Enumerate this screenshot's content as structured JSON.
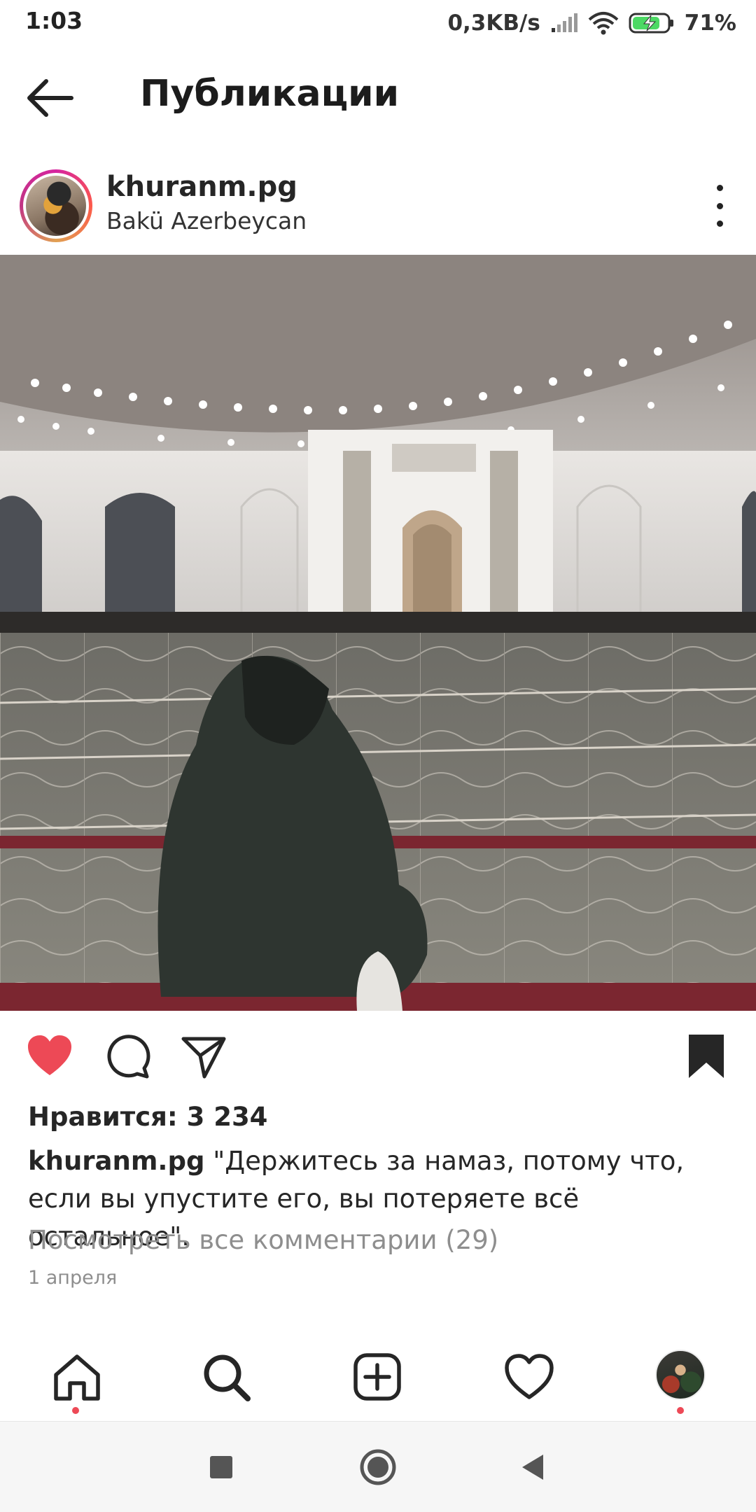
{
  "status_bar": {
    "time": "1:03",
    "net_speed": "0,3KB/s",
    "battery": "71%",
    "icons": [
      "signal-icon",
      "wifi-icon",
      "battery-charging-icon"
    ]
  },
  "header": {
    "title": "Публикации",
    "back_icon": "arrow-left-icon"
  },
  "post": {
    "username": "khuranm.pg",
    "location": "Bakü Azerbeycan",
    "more_icon": "more-vertical-icon",
    "likes": "Нравится: 3 234",
    "caption_user": "khuranm.pg",
    "caption_text": " \"Держитесь за намаз, потому что, если вы упустите его, вы потеряете всё остальное\".",
    "view_comments": "Посмотреть все комментарии (29)",
    "date": "1 апреля",
    "liked": true,
    "saved": true
  },
  "actions": {
    "like_icon": "heart-filled-icon",
    "comment_icon": "comment-icon",
    "share_icon": "send-icon",
    "save_icon": "bookmark-filled-icon"
  },
  "bottom_nav": {
    "items": [
      "home-icon",
      "search-icon",
      "add-post-icon",
      "activity-heart-icon",
      "profile-avatar"
    ],
    "active": "home-icon"
  },
  "system_nav": {
    "items": [
      "recents-square-icon",
      "home-circle-icon",
      "back-triangle-icon"
    ]
  },
  "colors": {
    "like_red": "#ed4956",
    "text_primary": "#262626",
    "text_secondary": "#8e8e8e"
  }
}
